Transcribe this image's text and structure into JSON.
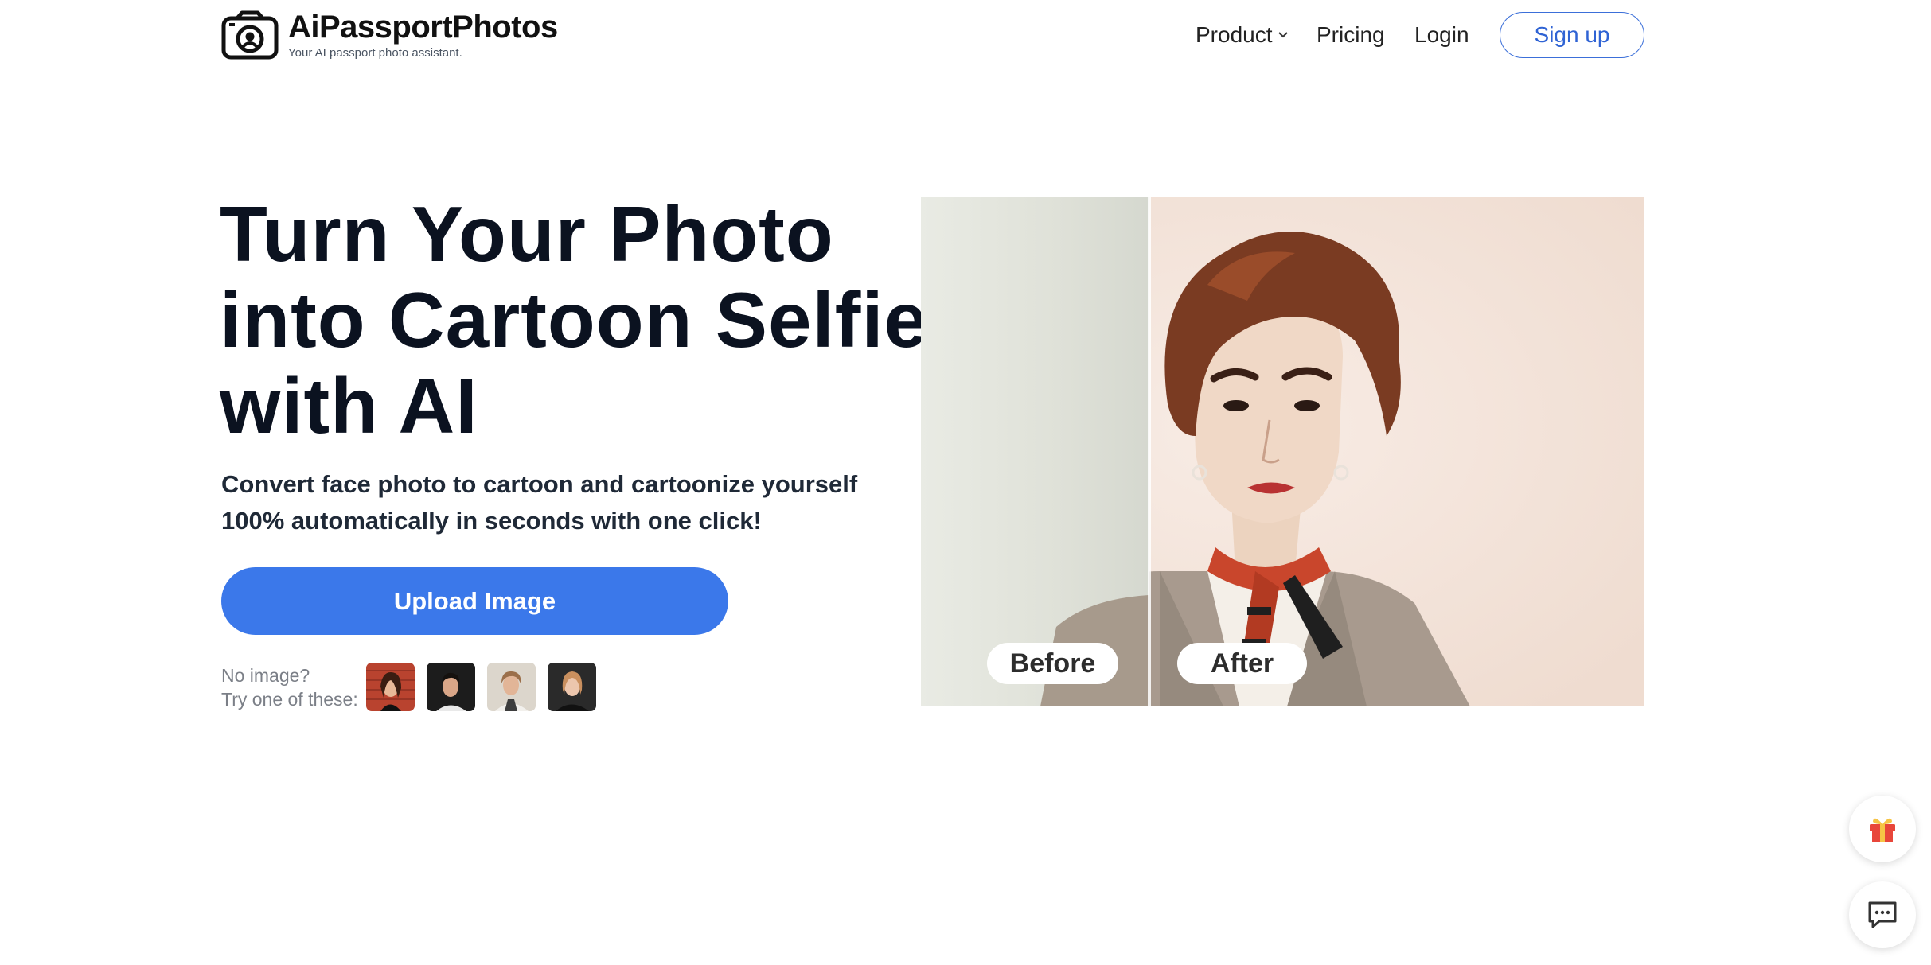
{
  "header": {
    "brand_name": "AiPassportPhotos",
    "brand_tagline": "Your AI passport photo assistant.",
    "logo_icon": "camera-icon",
    "nav": {
      "product": "Product",
      "pricing": "Pricing",
      "login": "Login"
    },
    "signup_label": "Sign up"
  },
  "hero": {
    "title_line1": "Turn Your Photo",
    "title_line2": "into Cartoon Selfie",
    "title_line3": "with AI",
    "subtitle": "Convert face photo to cartoon and cartoonize yourself 100% automatically in seconds with one click!",
    "upload_label": "Upload Image",
    "try_line1": "No image?",
    "try_line2": "Try one of these:",
    "sample_count_shown": 4
  },
  "compare": {
    "before_label": "Before",
    "after_label": "After"
  },
  "floating": {
    "gift_icon": "gift-icon",
    "chat_icon": "chat-icon"
  },
  "colors": {
    "primary": "#3b78ea",
    "signup_border": "#3b6fd9",
    "heading": "#0b1220"
  }
}
